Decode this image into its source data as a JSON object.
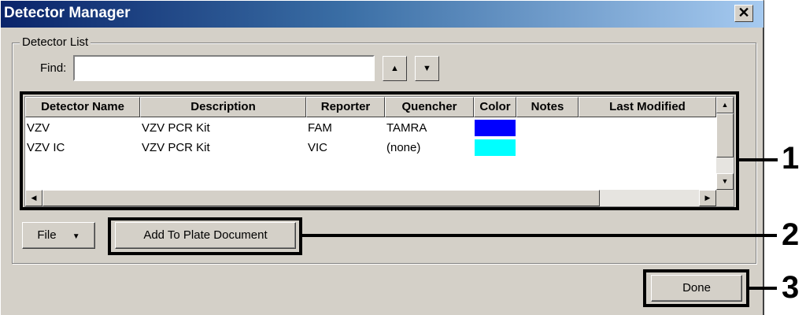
{
  "window": {
    "title": "Detector Manager",
    "close_glyph": "✕"
  },
  "detector_list": {
    "group_label": "Detector List",
    "find_label": "Find:",
    "find_value": "",
    "up_glyph": "▲",
    "down_glyph": "▼",
    "columns": [
      "Detector Name",
      "Description",
      "Reporter",
      "Quencher",
      "Color",
      "Notes",
      "Last Modified"
    ],
    "rows": [
      {
        "name": "VZV",
        "description": "VZV PCR Kit",
        "reporter": "FAM",
        "quencher": "TAMRA",
        "color": "#0000ff",
        "notes": "",
        "last_modified": ""
      },
      {
        "name": "VZV IC",
        "description": "VZV PCR Kit",
        "reporter": "VIC",
        "quencher": "(none)",
        "color": "#00ffff",
        "notes": "",
        "last_modified": ""
      }
    ]
  },
  "scroll": {
    "up": "▲",
    "down": "▼",
    "left": "◀",
    "right": "▶"
  },
  "buttons": {
    "file_label": "File",
    "file_arrow": "▼",
    "add_to_plate_label": "Add To Plate Document",
    "done_label": "Done"
  },
  "callouts": [
    "1",
    "2",
    "3"
  ],
  "colors": {
    "title_bar": "#0a246a",
    "dialog_bg": "#d4d0c8"
  }
}
